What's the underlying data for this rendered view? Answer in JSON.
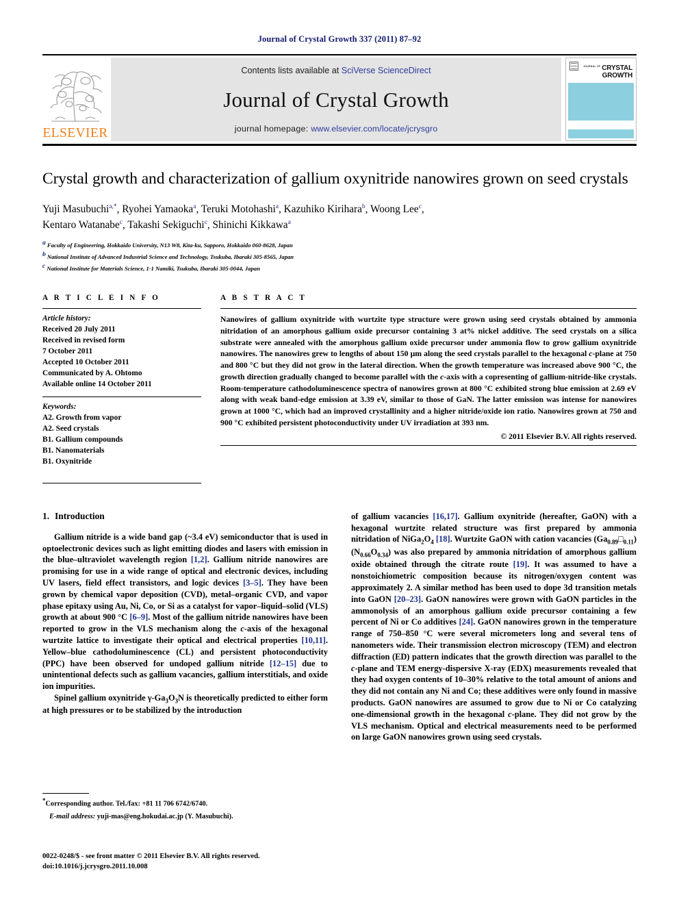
{
  "running_head": "Journal of Crystal Growth 337 (2011) 87–92",
  "masthead": {
    "publisher_wordmark": "ELSEVIER",
    "contents_prefix": "Contents lists available at ",
    "contents_link": "SciVerse ScienceDirect",
    "journal_title": "Journal of Crystal Growth",
    "homepage_prefix": "journal homepage: ",
    "homepage_link": "www.elsevier.com/locate/jcrysgro",
    "cover": {
      "kicker": "JOURNAL OF",
      "line1": "CRYSTAL",
      "line2": "GROWTH"
    }
  },
  "article": {
    "title": "Crystal growth and characterization of gallium oxynitride nanowires grown on seed crystals",
    "authors_line1": "Yuji Masubuchi a,*, Ryohei Yamaoka a, Teruki Motohashi a, Kazuhiko Kirihara b, Woong Lee c,",
    "authors_line2": "Kentaro Watanabe c, Takashi Sekiguchi c, Shinichi Kikkawa a",
    "affiliations": [
      {
        "mark": "a",
        "text": "Faculty of Engineering, Hokkaido University, N13 W8, Kita-ku, Sapporo, Hokkaido 060-8628, Japan"
      },
      {
        "mark": "b",
        "text": "National Institute of Advanced Industrial Science and Technology, Tsukuba, Ibaraki 305-8565, Japan"
      },
      {
        "mark": "c",
        "text": "National Institute for Materials Science, 1-1 Namiki, Tsukuba, Ibaraki 305-0044, Japan"
      }
    ]
  },
  "article_info": {
    "heading": "A R T I C L E   I N F O",
    "history_label": "Article history:",
    "history": [
      "Received 20 July 2011",
      "Received in revised form",
      "7 October 2011",
      "Accepted 10 October 2011",
      "Communicated by A. Ohtomo",
      "Available online 14 October 2011"
    ],
    "keywords_label": "Keywords:",
    "keywords": [
      "A2. Growth from vapor",
      "A2. Seed crystals",
      "B1. Gallium compounds",
      "B1. Nanomaterials",
      "B1. Oxynitride"
    ]
  },
  "abstract": {
    "heading": "A B S T R A C T",
    "text": "Nanowires of gallium oxynitride with wurtzite type structure were grown using seed crystals obtained by ammonia nitridation of an amorphous gallium oxide precursor containing 3 at% nickel additive. The seed crystals on a silica substrate were annealed with the amorphous gallium oxide precursor under ammonia flow to grow gallium oxynitride nanowires. The nanowires grew to lengths of about 150 μm along the seed crystals parallel to the hexagonal c-plane at 750 and 800 °C but they did not grow in the lateral direction. When the growth temperature was increased above 900 °C, the growth direction gradually changed to become parallel with the c-axis with a copresenting of gallium-nitride-like crystals. Room-temperature cathodoluminescence spectra of nanowires grown at 800 °C exhibited strong blue emission at 2.69 eV along with weak band-edge emission at 3.39 eV, similar to those of GaN. The latter emission was intense for nanowires grown at 1000 °C, which had an improved crystallinity and a higher nitride/oxide ion ratio. Nanowires grown at 750 and 900 °C exhibited persistent photoconductivity under UV irradiation at 393 nm.",
    "copyright": "© 2011 Elsevier B.V. All rights reserved."
  },
  "introduction": {
    "number": "1.",
    "heading": "Introduction",
    "paragraph1": "Gallium nitride is a wide band gap (~3.4 eV) semiconductor that is used in optoelectronic devices such as light emitting diodes and lasers with emission in the blue–ultraviolet wavelength region [1,2]. Gallium nitride nanowires are promising for use in a wide range of optical and electronic devices, including UV lasers, field effect transistors, and logic devices [3–5]. They have been grown by chemical vapor deposition (CVD), metal–organic CVD, and vapor phase epitaxy using Au, Ni, Co, or Si as a catalyst for vapor–liquid–solid (VLS) growth at about 900 °C [6–9]. Most of the gallium nitride nanowires have been reported to grow in the VLS mechanism along the c-axis of the hexagonal wurtzite lattice to investigate their optical and electrical properties [10,11]. Yellow–blue cathodoluminescence (CL) and persistent photoconductivity (PPC) have been observed for undoped gallium nitride [12–15] due to unintentional defects such as gallium vacancies, gallium interstitials, and oxide ion impurities.",
    "paragraph2": "Spinel gallium oxynitride γ-Ga3O3N is theoretically predicted to either form at high pressures or to be stabilized by the introduction of gallium vacancies [16,17]. Gallium oxynitride (hereafter, GaON) with a hexagonal wurtzite related structure was first prepared by ammonia nitridation of NiGa2O4 [18]. Wurtzite GaON with cation vacancies (Ga0.89□0.11)(N0.66O0.34) was also prepared by ammonia nitridation of amorphous gallium oxide obtained through the citrate route [19]. It was assumed to have a nonstoichiometric composition because its nitrogen/oxygen content was approximately 2. A similar method has been used to dope 3d transition metals into GaON [20–23]. GaON nanowires were grown with GaON particles in the ammonolysis of an amorphous gallium oxide precursor containing a few percent of Ni or Co additives [24]. GaON nanowires grown in the temperature range of 750–850 °C were several micrometers long and several tens of nanometers wide. Their transmission electron microscopy (TEM) and electron diffraction (ED) pattern indicates that the growth direction was parallel to the c-plane and TEM energy-dispersive X-ray (EDX) measurements revealed that they had oxygen contents of 10–30% relative to the total amount of anions and they did not contain any Ni and Co; these additives were only found in massive products. GaON nanowires are assumed to grow due to Ni or Co catalyzing one-dimensional growth in the hexagonal c-plane. They did not grow by the VLS mechanism. Optical and electrical measurements need to be performed on large GaON nanowires grown using seed crystals."
  },
  "footnotes": {
    "corresponding": "Corresponding author. Tel./fax: +81 11 706 6742/6740.",
    "email_label": "E-mail address:",
    "email": "yuji-mas@eng.hokudai.ac.jp (Y. Masubuchi).",
    "issn_line": "0022-0248/$ - see front matter © 2011 Elsevier B.V. All rights reserved.",
    "doi_line": "doi:10.1016/j.jcrysgro.2011.10.008"
  },
  "colors": {
    "running_head": "#111a6e",
    "link": "#2b3c9b",
    "citation": "#1b2f8f",
    "elsevier_orange": "#f07f1a",
    "banner_gray": "#e4e4e4",
    "cover_blue": "#8ccfdf"
  }
}
